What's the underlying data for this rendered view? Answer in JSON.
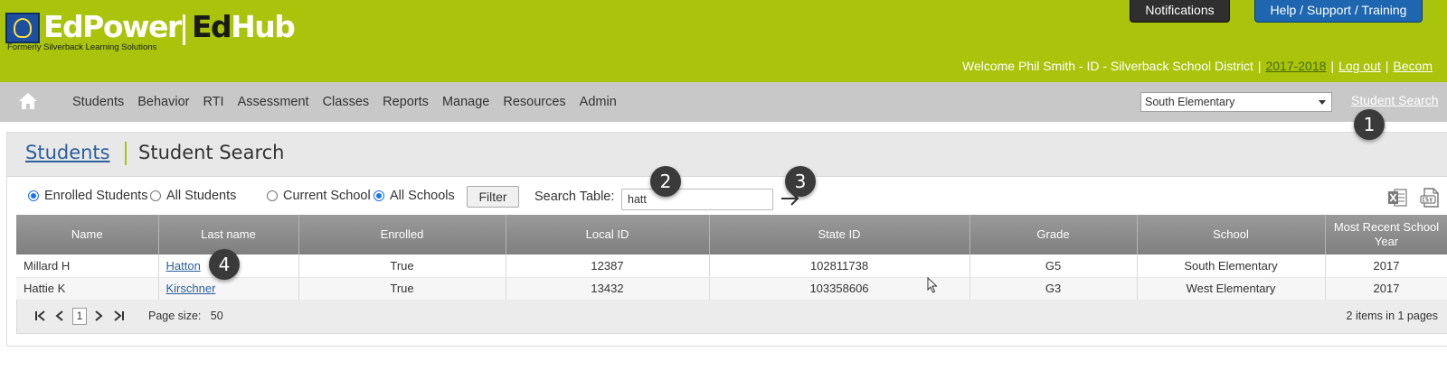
{
  "header": {
    "logo": {
      "brand": "EdPower",
      "product_ed": "Ed",
      "product_hub": "Hub",
      "tagline": "Formerly Silverback Learning Solutions"
    },
    "notifications_label": "Notifications",
    "help_label": "Help / Support / Training",
    "welcome_text": "Welcome Phil Smith - ID - Silverback School District",
    "year_link": "2017-2018",
    "logout_link": "Log out",
    "become_link": "Becom"
  },
  "nav": {
    "items": [
      "Students",
      "Behavior",
      "RTI",
      "Assessment",
      "Classes",
      "Reports",
      "Manage",
      "Resources",
      "Admin"
    ],
    "school_select": "South Elementary",
    "student_search_link": "Student Search"
  },
  "title": {
    "breadcrumb_parent": "Students",
    "breadcrumb_current": "Student Search"
  },
  "filters": {
    "enrolled_students": "Enrolled Students",
    "all_students": "All Students",
    "current_school": "Current School",
    "all_schools": "All Schools",
    "enrolled_selected": true,
    "all_schools_selected": true,
    "filter_button": "Filter",
    "search_label": "Search Table:",
    "search_value": "hatt"
  },
  "table": {
    "columns": [
      "Name",
      "Last name",
      "Enrolled",
      "Local ID",
      "State ID",
      "Grade",
      "School",
      "Most Recent School Year"
    ],
    "rows": [
      {
        "name": "Millard H",
        "last_name": "Hatton",
        "enrolled": "True",
        "local_id": "12387",
        "state_id": "102811738",
        "grade": "G5",
        "school": "South Elementary",
        "year": "2017"
      },
      {
        "name": "Hattie K",
        "last_name": "Kirschner",
        "enrolled": "True",
        "local_id": "13432",
        "state_id": "103358606",
        "grade": "G3",
        "school": "West Elementary",
        "year": "2017"
      }
    ]
  },
  "pager": {
    "current_page": "1",
    "page_size_label": "Page size:",
    "page_size": "50",
    "summary": "2 items in 1 pages"
  },
  "callouts": [
    "1",
    "2",
    "3",
    "4"
  ],
  "colors": {
    "header_green": "#a9c40a",
    "nav_gray": "#c8c8c8",
    "link_blue": "#2a5e9c",
    "help_blue": "#1e66b0",
    "callout_dark": "#3a3a3a"
  }
}
